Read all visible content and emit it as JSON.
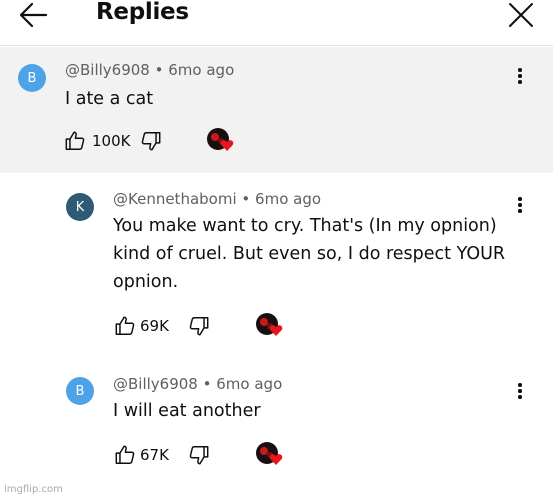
{
  "header": {
    "title": "Replies",
    "back_icon": "arrow-left-icon",
    "close_icon": "close-icon"
  },
  "comments": [
    {
      "avatar_letter": "B",
      "avatar_color": "#4ea3e8",
      "handle": "@Billy6908",
      "age": "6mo ago",
      "text": "I ate a cat",
      "likes": "100K"
    },
    {
      "avatar_letter": "K",
      "avatar_color": "#2f5a74",
      "handle": "@Kennethabomi",
      "age": "6mo ago",
      "text_lines": [
        "You make want to cry. That's (In my opnion)",
        "kind of cruel. But even so, I do respect YOUR",
        "opnion."
      ],
      "likes": "69K"
    },
    {
      "avatar_letter": "B",
      "avatar_color": "#4ea3e8",
      "handle": "@Billy6908",
      "age": "6mo ago",
      "text": "I will eat another",
      "likes": "67K"
    }
  ],
  "meta_separator": "•",
  "icons": {
    "like": "thumbs-up-icon",
    "dislike": "thumbs-down-icon",
    "more": "more-vert-icon",
    "creator_heart": "heart-icon"
  },
  "colors": {
    "highlight_bg": "#f2f2f2",
    "heart": "#e8141e"
  },
  "watermark": "imgflip.com"
}
